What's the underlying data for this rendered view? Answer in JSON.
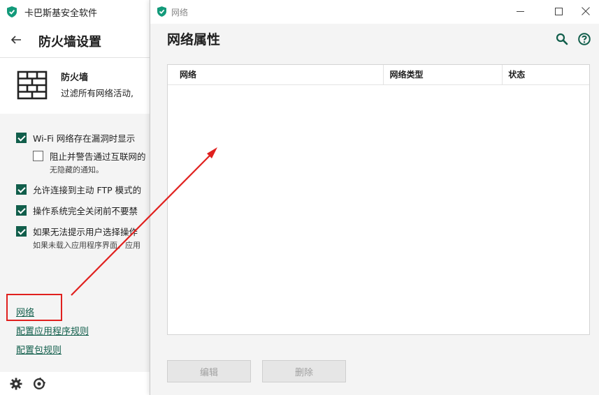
{
  "main_window": {
    "app_title": "卡巴斯基安全软件",
    "page_title": "防火墙设置",
    "component": {
      "name": "防火墙",
      "description": "过滤所有网络活动,"
    },
    "options": [
      {
        "label": "Wi-Fi 网络存在漏洞时显示",
        "checked": true
      },
      {
        "label": "阻止并警告通过互联网的",
        "checked": false,
        "sub": "无隐藏的通知。"
      },
      {
        "label": "允许连接到主动 FTP 模式的",
        "checked": true
      },
      {
        "label": "操作系统完全关闭前不要禁",
        "checked": true
      },
      {
        "label": "如果无法提示用户选择操作",
        "checked": true,
        "sub": "如果未载入应用程序界面，应用"
      }
    ],
    "links": {
      "networks": "网络",
      "app_rules": "配置应用程序规则",
      "packet_rules": "配置包规则"
    },
    "footer_icons": [
      "gear-icon",
      "support-icon"
    ]
  },
  "network_dialog": {
    "window_title": "网络",
    "heading": "网络属性",
    "columns": [
      "网络",
      "网络类型",
      "状态"
    ],
    "rows": [],
    "buttons": {
      "edit": "编辑",
      "delete": "删除"
    }
  },
  "colors": {
    "accent_green": "#115e4b",
    "annotation_red": "#e0201e",
    "disabled_text": "#a0a0a0"
  }
}
